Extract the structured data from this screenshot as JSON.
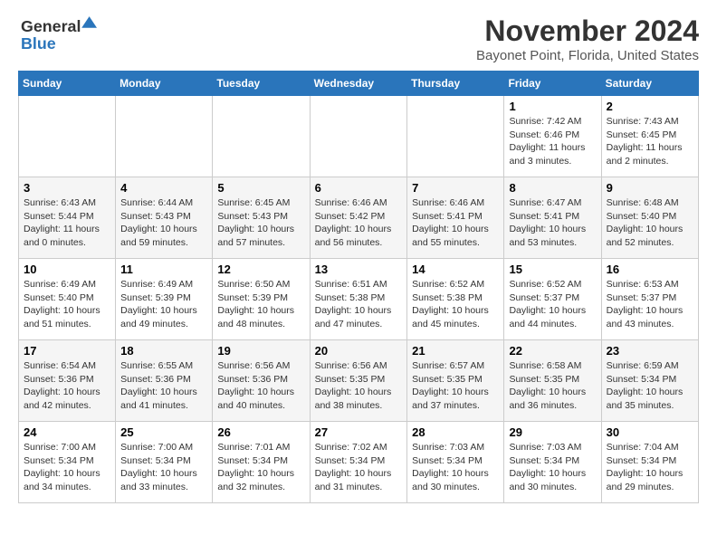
{
  "logo": {
    "line1": "General",
    "line2": "Blue"
  },
  "header": {
    "month": "November 2024",
    "location": "Bayonet Point, Florida, United States"
  },
  "days_of_week": [
    "Sunday",
    "Monday",
    "Tuesday",
    "Wednesday",
    "Thursday",
    "Friday",
    "Saturday"
  ],
  "weeks": [
    [
      {
        "day": "",
        "info": ""
      },
      {
        "day": "",
        "info": ""
      },
      {
        "day": "",
        "info": ""
      },
      {
        "day": "",
        "info": ""
      },
      {
        "day": "",
        "info": ""
      },
      {
        "day": "1",
        "info": "Sunrise: 7:42 AM\nSunset: 6:46 PM\nDaylight: 11 hours\nand 3 minutes."
      },
      {
        "day": "2",
        "info": "Sunrise: 7:43 AM\nSunset: 6:45 PM\nDaylight: 11 hours\nand 2 minutes."
      }
    ],
    [
      {
        "day": "3",
        "info": "Sunrise: 6:43 AM\nSunset: 5:44 PM\nDaylight: 11 hours\nand 0 minutes."
      },
      {
        "day": "4",
        "info": "Sunrise: 6:44 AM\nSunset: 5:43 PM\nDaylight: 10 hours\nand 59 minutes."
      },
      {
        "day": "5",
        "info": "Sunrise: 6:45 AM\nSunset: 5:43 PM\nDaylight: 10 hours\nand 57 minutes."
      },
      {
        "day": "6",
        "info": "Sunrise: 6:46 AM\nSunset: 5:42 PM\nDaylight: 10 hours\nand 56 minutes."
      },
      {
        "day": "7",
        "info": "Sunrise: 6:46 AM\nSunset: 5:41 PM\nDaylight: 10 hours\nand 55 minutes."
      },
      {
        "day": "8",
        "info": "Sunrise: 6:47 AM\nSunset: 5:41 PM\nDaylight: 10 hours\nand 53 minutes."
      },
      {
        "day": "9",
        "info": "Sunrise: 6:48 AM\nSunset: 5:40 PM\nDaylight: 10 hours\nand 52 minutes."
      }
    ],
    [
      {
        "day": "10",
        "info": "Sunrise: 6:49 AM\nSunset: 5:40 PM\nDaylight: 10 hours\nand 51 minutes."
      },
      {
        "day": "11",
        "info": "Sunrise: 6:49 AM\nSunset: 5:39 PM\nDaylight: 10 hours\nand 49 minutes."
      },
      {
        "day": "12",
        "info": "Sunrise: 6:50 AM\nSunset: 5:39 PM\nDaylight: 10 hours\nand 48 minutes."
      },
      {
        "day": "13",
        "info": "Sunrise: 6:51 AM\nSunset: 5:38 PM\nDaylight: 10 hours\nand 47 minutes."
      },
      {
        "day": "14",
        "info": "Sunrise: 6:52 AM\nSunset: 5:38 PM\nDaylight: 10 hours\nand 45 minutes."
      },
      {
        "day": "15",
        "info": "Sunrise: 6:52 AM\nSunset: 5:37 PM\nDaylight: 10 hours\nand 44 minutes."
      },
      {
        "day": "16",
        "info": "Sunrise: 6:53 AM\nSunset: 5:37 PM\nDaylight: 10 hours\nand 43 minutes."
      }
    ],
    [
      {
        "day": "17",
        "info": "Sunrise: 6:54 AM\nSunset: 5:36 PM\nDaylight: 10 hours\nand 42 minutes."
      },
      {
        "day": "18",
        "info": "Sunrise: 6:55 AM\nSunset: 5:36 PM\nDaylight: 10 hours\nand 41 minutes."
      },
      {
        "day": "19",
        "info": "Sunrise: 6:56 AM\nSunset: 5:36 PM\nDaylight: 10 hours\nand 40 minutes."
      },
      {
        "day": "20",
        "info": "Sunrise: 6:56 AM\nSunset: 5:35 PM\nDaylight: 10 hours\nand 38 minutes."
      },
      {
        "day": "21",
        "info": "Sunrise: 6:57 AM\nSunset: 5:35 PM\nDaylight: 10 hours\nand 37 minutes."
      },
      {
        "day": "22",
        "info": "Sunrise: 6:58 AM\nSunset: 5:35 PM\nDaylight: 10 hours\nand 36 minutes."
      },
      {
        "day": "23",
        "info": "Sunrise: 6:59 AM\nSunset: 5:34 PM\nDaylight: 10 hours\nand 35 minutes."
      }
    ],
    [
      {
        "day": "24",
        "info": "Sunrise: 7:00 AM\nSunset: 5:34 PM\nDaylight: 10 hours\nand 34 minutes."
      },
      {
        "day": "25",
        "info": "Sunrise: 7:00 AM\nSunset: 5:34 PM\nDaylight: 10 hours\nand 33 minutes."
      },
      {
        "day": "26",
        "info": "Sunrise: 7:01 AM\nSunset: 5:34 PM\nDaylight: 10 hours\nand 32 minutes."
      },
      {
        "day": "27",
        "info": "Sunrise: 7:02 AM\nSunset: 5:34 PM\nDaylight: 10 hours\nand 31 minutes."
      },
      {
        "day": "28",
        "info": "Sunrise: 7:03 AM\nSunset: 5:34 PM\nDaylight: 10 hours\nand 30 minutes."
      },
      {
        "day": "29",
        "info": "Sunrise: 7:03 AM\nSunset: 5:34 PM\nDaylight: 10 hours\nand 30 minutes."
      },
      {
        "day": "30",
        "info": "Sunrise: 7:04 AM\nSunset: 5:34 PM\nDaylight: 10 hours\nand 29 minutes."
      }
    ]
  ]
}
